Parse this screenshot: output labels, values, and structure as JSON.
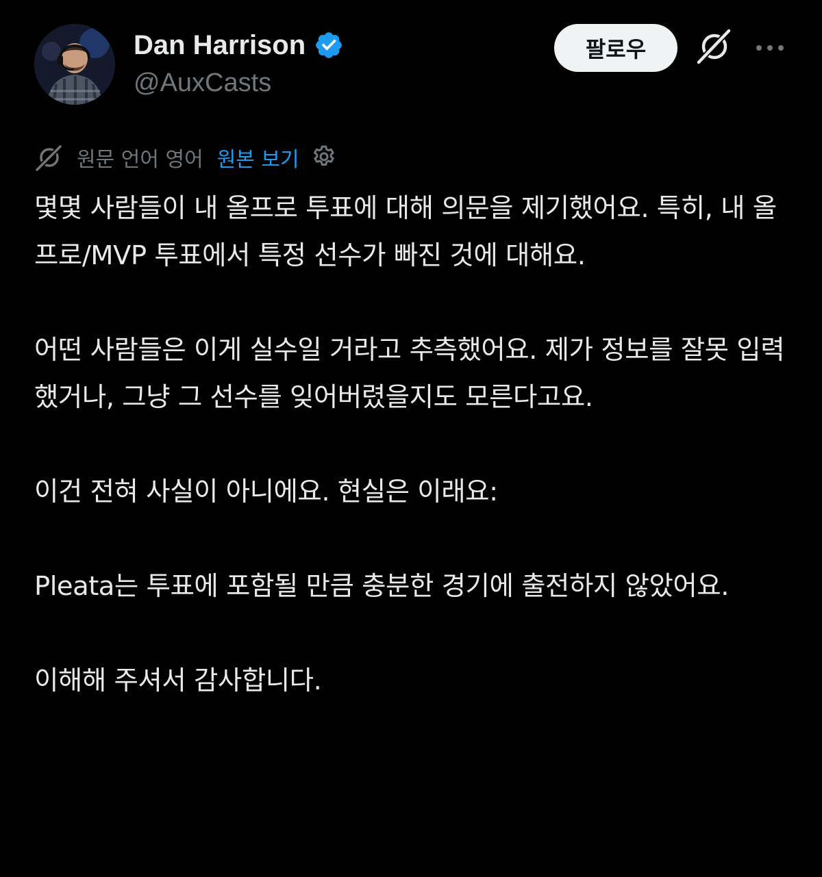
{
  "author": {
    "display_name": "Dan Harrison",
    "handle": "@AuxCasts",
    "verified": true
  },
  "actions": {
    "follow_label": "팔로우",
    "grok_icon": "grok-icon",
    "more_icon": "more-icon"
  },
  "translation": {
    "source_label": "원문 언어 영어",
    "view_original_label": "원본 보기",
    "settings_icon": "gear-icon"
  },
  "tweet": {
    "paragraphs": [
      "몇몇 사람들이 내 올프로 투표에 대해 의문을 제기했어요. 특히, 내 올프로/MVP 투표에서 특정 선수가 빠진 것에 대해요.",
      "어떤 사람들은 이게 실수일 거라고 추측했어요. 제가 정보를 잘못 입력했거나, 그냥 그 선수를 잊어버렸을지도 모른다고요.",
      "이건 전혀 사실이 아니에요. 현실은 이래요:",
      "Pleata는 투표에 포함될 만큼 충분한 경기에 출전하지 않았어요.",
      "이해해 주셔서 감사합니다."
    ]
  },
  "colors": {
    "background": "#000000",
    "text_primary": "#e7e9ea",
    "text_secondary": "#71767b",
    "link": "#1d9bf0",
    "verified_badge": "#1d9bf0",
    "follow_button_bg": "#eff3f4"
  }
}
